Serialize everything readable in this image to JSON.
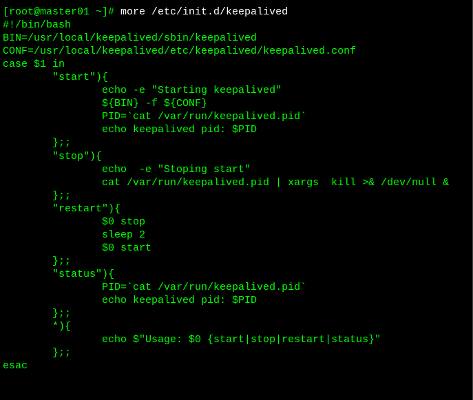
{
  "terminal": {
    "prompt": "[root@master01 ~]# ",
    "command": "more /etc/init.d/keepalived",
    "lines": [
      "#!/bin/bash",
      "",
      "BIN=/usr/local/keepalived/sbin/keepalived",
      "CONF=/usr/local/keepalived/etc/keepalived/keepalived.conf",
      "",
      "case $1 in",
      "        \"start\"){",
      "                echo -e \"Starting keepalived\"",
      "                ${BIN} -f ${CONF}",
      "                PID=`cat /var/run/keepalived.pid`",
      "                echo keepalived pid: $PID",
      "        };;",
      "        \"stop\"){",
      "                echo  -e \"Stoping start\"",
      "                cat /var/run/keepalived.pid | xargs  kill >& /dev/null &",
      "        };;",
      "        \"restart\"){",
      "                $0 stop",
      "                sleep 2",
      "                $0 start",
      "        };;",
      "        \"status\"){",
      "                PID=`cat /var/run/keepalived.pid`",
      "                echo keepalived pid: $PID",
      "        };;",
      "        *){",
      "                echo $\"Usage: $0 {start|stop|restart|status}\"",
      "        };;",
      "esac"
    ]
  }
}
